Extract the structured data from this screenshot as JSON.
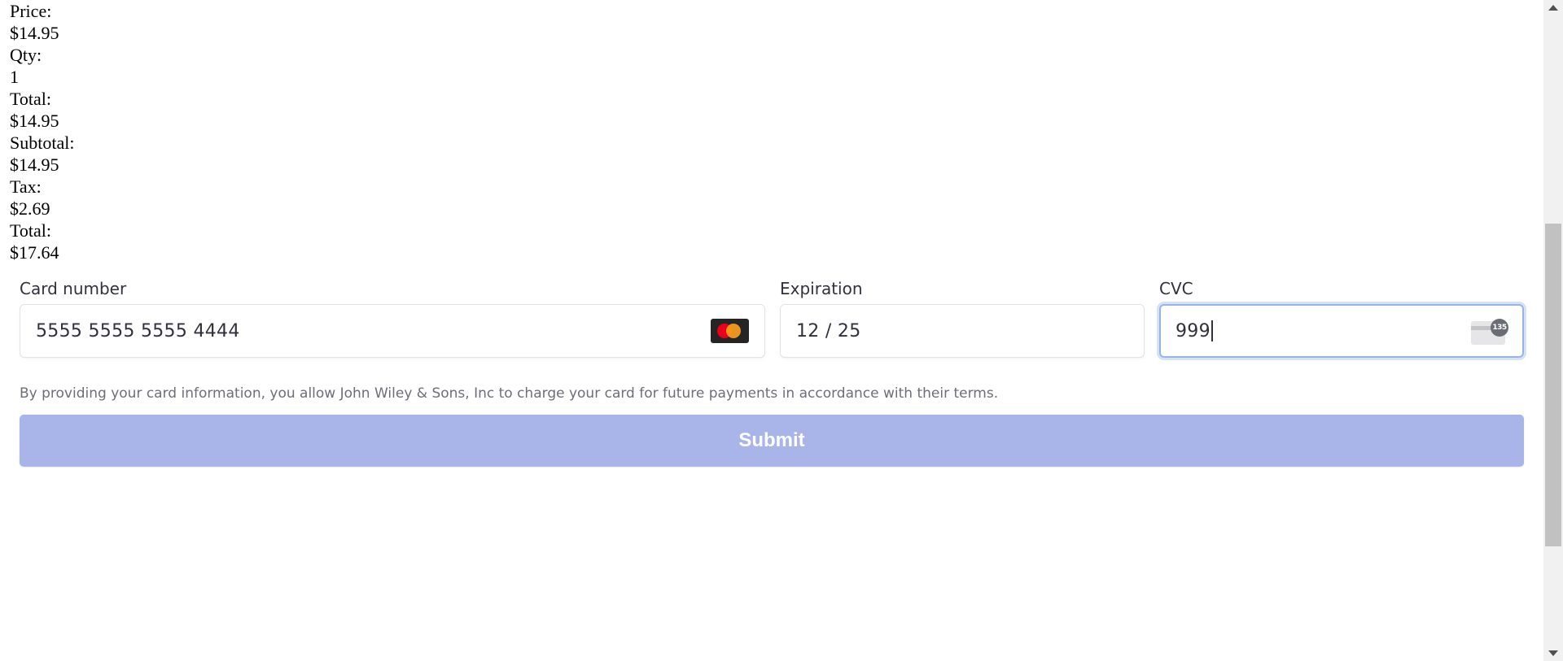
{
  "summary": {
    "rows": [
      {
        "label": "Price:",
        "value": "$14.95"
      },
      {
        "label": "Qty:",
        "value": "1"
      },
      {
        "label": "Total:",
        "value": "$14.95"
      },
      {
        "label": "Subtotal:",
        "value": "$14.95"
      },
      {
        "label": "Tax:",
        "value": "$2.69"
      },
      {
        "label": "Total:",
        "value": "$17.64"
      }
    ]
  },
  "payment": {
    "card_number": {
      "label": "Card number",
      "value": "5555 5555 5555 4444",
      "brand_icon": "mastercard-icon"
    },
    "expiration": {
      "label": "Expiration",
      "value": "12 / 25"
    },
    "cvc": {
      "label": "CVC",
      "value": "999",
      "hint_icon": "cvc-card-icon",
      "hint_badge": "135"
    },
    "terms": "By providing your card information, you allow John Wiley & Sons, Inc to charge your card for future payments in accordance with their terms.",
    "submit_label": "Submit",
    "colors": {
      "submit_bg": "#a9b4e8",
      "focus_border": "#97b4ea",
      "text": "#30313d",
      "muted": "#6d6e78"
    }
  }
}
